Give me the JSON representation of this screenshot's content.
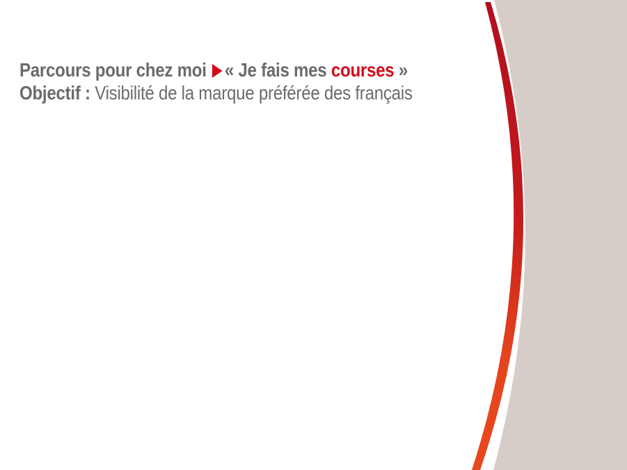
{
  "slide": {
    "line1": {
      "prefix": "Parcours pour chez moi",
      "arrow_icon": "right-triangle-icon",
      "quote_open": "« Je fais mes ",
      "highlight": "courses",
      "quote_close": " »"
    },
    "line2": {
      "label": "Objectif :",
      "text": " Visibilité de la marque préférée des français"
    }
  },
  "colors": {
    "text_grey": "#6b6b6d",
    "accent_red": "#d40a19",
    "arc_orange": "#e8461e",
    "panel_beige": "#d7cdc8"
  }
}
